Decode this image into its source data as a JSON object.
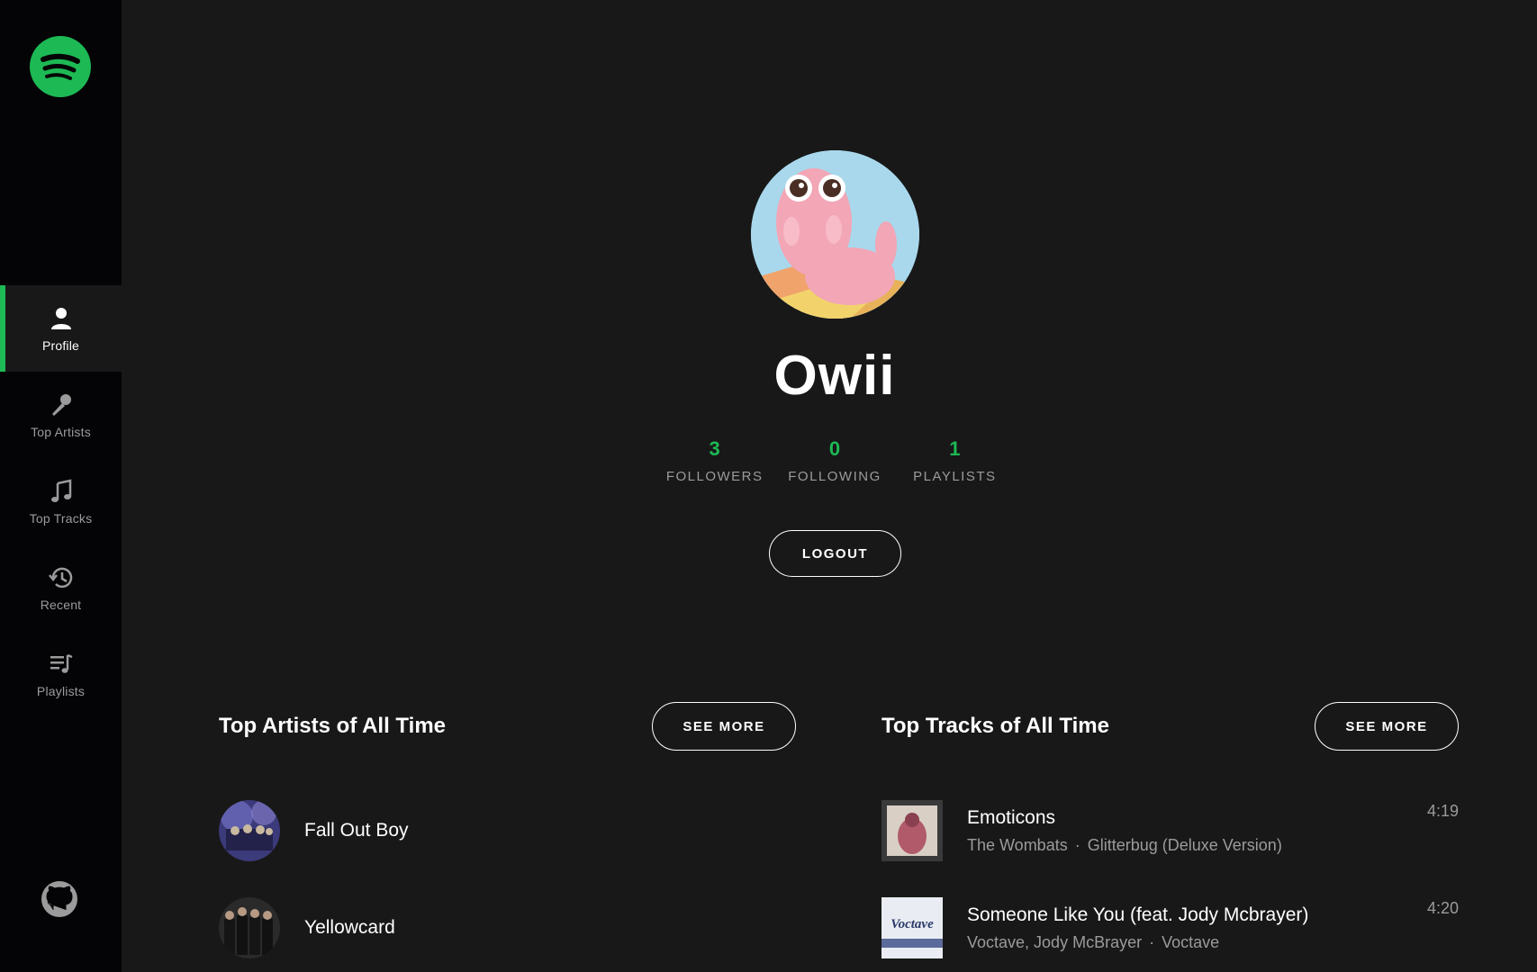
{
  "sidebar": {
    "logo": "spotify-logo",
    "items": [
      {
        "label": "Profile",
        "icon": "user-icon",
        "active": true
      },
      {
        "label": "Top Artists",
        "icon": "microphone-icon",
        "active": false
      },
      {
        "label": "Top Tracks",
        "icon": "music-note-icon",
        "active": false
      },
      {
        "label": "Recent",
        "icon": "history-icon",
        "active": false
      },
      {
        "label": "Playlists",
        "icon": "playlist-icon",
        "active": false
      }
    ],
    "github_icon": "github-icon"
  },
  "profile": {
    "username": "Owii",
    "stats": [
      {
        "value": "3",
        "label": "FOLLOWERS"
      },
      {
        "value": "0",
        "label": "FOLLOWING"
      },
      {
        "value": "1",
        "label": "PLAYLISTS"
      }
    ],
    "logout_label": "LOGOUT"
  },
  "top_artists": {
    "title": "Top Artists of All Time",
    "see_more_label": "SEE MORE",
    "items": [
      {
        "name": "Fall Out Boy"
      },
      {
        "name": "Yellowcard"
      }
    ]
  },
  "top_tracks": {
    "title": "Top Tracks of All Time",
    "see_more_label": "SEE MORE",
    "items": [
      {
        "name": "Emoticons",
        "artists": "The Wombats",
        "album": "Glitterbug (Deluxe Version)",
        "duration": "4:19",
        "separator": "·"
      },
      {
        "name": "Someone Like You (feat. Jody Mcbrayer)",
        "artists": "Voctave, Jody McBrayer",
        "album": "Voctave",
        "duration": "4:20",
        "separator": "·",
        "cover_text": "Voctave"
      }
    ]
  },
  "colors": {
    "accent": "#1DB954",
    "background": "#181818",
    "sidebar": "#040306",
    "muted_text": "#9b9b9b"
  }
}
